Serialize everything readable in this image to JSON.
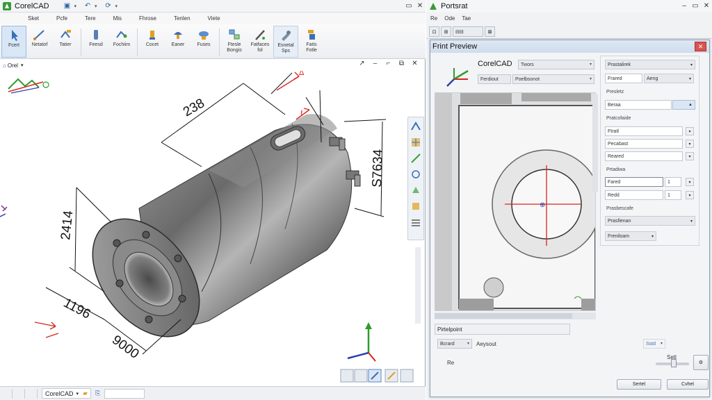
{
  "cad": {
    "app_title": "CorelCAD",
    "menu": [
      "Sket",
      "Pcfe",
      "Tere",
      "Mis",
      "Fhrose",
      "Tenlen",
      "Viete"
    ],
    "ribbon": [
      {
        "label": "Fcert",
        "icon": "pointer-icon"
      },
      {
        "label": "Netatof",
        "icon": "line-icon"
      },
      {
        "label": "Tatier",
        "icon": "move-icon"
      },
      {
        "label": "Feesd",
        "icon": "mirror-icon"
      },
      {
        "label": "Fochiim",
        "icon": "extrude-icon"
      },
      {
        "label": "Cocet",
        "icon": "shape-icon"
      },
      {
        "label": "Eaner",
        "icon": "fill-icon"
      },
      {
        "label": "Fuses",
        "icon": "cloud-icon"
      },
      {
        "label": "Ftesle\nBongis",
        "icon": "blocks-icon"
      },
      {
        "label": "Fatfaces\nfol",
        "icon": "pencil-icon"
      },
      {
        "label": "Esnetal\nSps",
        "icon": "tool-icon"
      },
      {
        "label": "Fatis\nFotle",
        "icon": "layers-icon"
      }
    ],
    "view_tab": "Orel",
    "dimensions": {
      "d_top": "238",
      "d_right": "S7634",
      "d_left": "2414",
      "d_bottom_left": "1196",
      "d_bottom": "9000"
    },
    "status_app": "CorelCAD",
    "colors": {
      "accent": "#2f64a8",
      "dim_red": "#d9231d",
      "axis_green": "#2e9b2e",
      "axis_blue": "#2a3fae"
    }
  },
  "print": {
    "window_title": "Portsrat",
    "menu": [
      "Re",
      "Ode",
      "Tae"
    ],
    "dialog_title": "Frint Preview",
    "printer_name": "CorelCAD",
    "combo_printer": "Twors",
    "combo_paper_label": "Ferdiout",
    "combo_paper_value": "Poelbsonot",
    "panel": {
      "head": "Prastalirek",
      "r1_label": "Frared",
      "r1_value": "Aeng",
      "l1": "Presletz",
      "r2": "Beraa",
      "l2": "Pratcofaide",
      "r3": "Ftratl",
      "r4": "Pecabast",
      "r5": "Reared",
      "l3": "Prtadiwa",
      "r6": "Fared",
      "r6_num": "1",
      "r7": "Redd",
      "r7_num": "1",
      "l4": "Prasbescafe",
      "r8": "Prasfienan",
      "r9": "Freniloam"
    },
    "bottom": {
      "section": "Pirtelpoint",
      "combo": "Bcrard",
      "combo_label": "Aeysout",
      "right_label": "Sstd",
      "re_label": "Re",
      "scale_label": "Setl",
      "btn_ok": "Sertel",
      "btn_cancel": "Cvhel"
    }
  }
}
